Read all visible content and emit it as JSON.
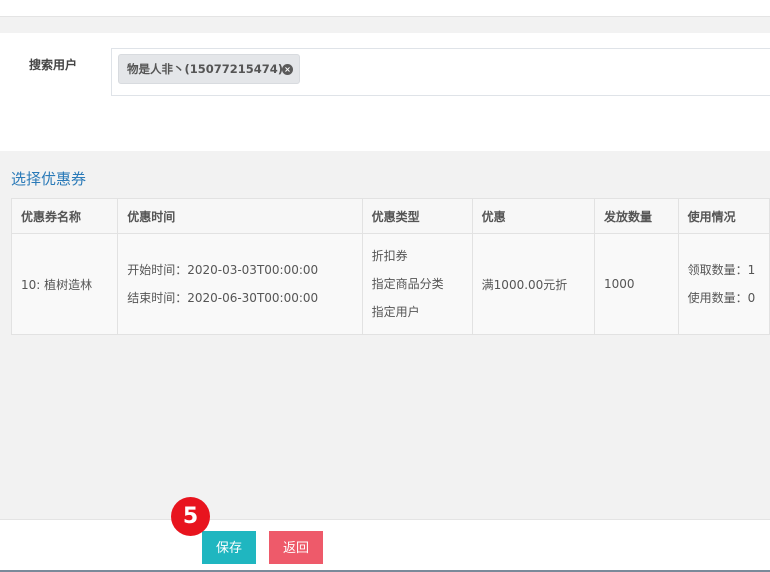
{
  "form": {
    "user_label": "搜索用户",
    "selected_user": "物是人非丶(15077215474)",
    "tag_remove": "×"
  },
  "coupon": {
    "section_title": "选择优惠券",
    "headers": [
      "优惠券名称",
      "优惠时间",
      "优惠类型",
      "优惠",
      "发放数量",
      "使用情况"
    ],
    "row": {
      "name": "10: 植树造林",
      "start": "开始时间：2020-03-03T00:00:00",
      "end": "结束时间：2020-06-30T00:00:00",
      "type_1": "折扣券",
      "type_2": "指定商品分类",
      "type_3": "指定用户",
      "discount": "满1000.00元折",
      "quantity": "1000",
      "received": "领取数量：1",
      "used": "使用数量：0"
    }
  },
  "actions": {
    "save_label": "保存",
    "back_label": "返回"
  },
  "annotation": {
    "step_number": "5"
  },
  "colors": {
    "save_button": "#1fb6c0",
    "back_button": "#ee5a6a",
    "section_title": "#2a7ab8",
    "step_badge": "#e8141e"
  }
}
